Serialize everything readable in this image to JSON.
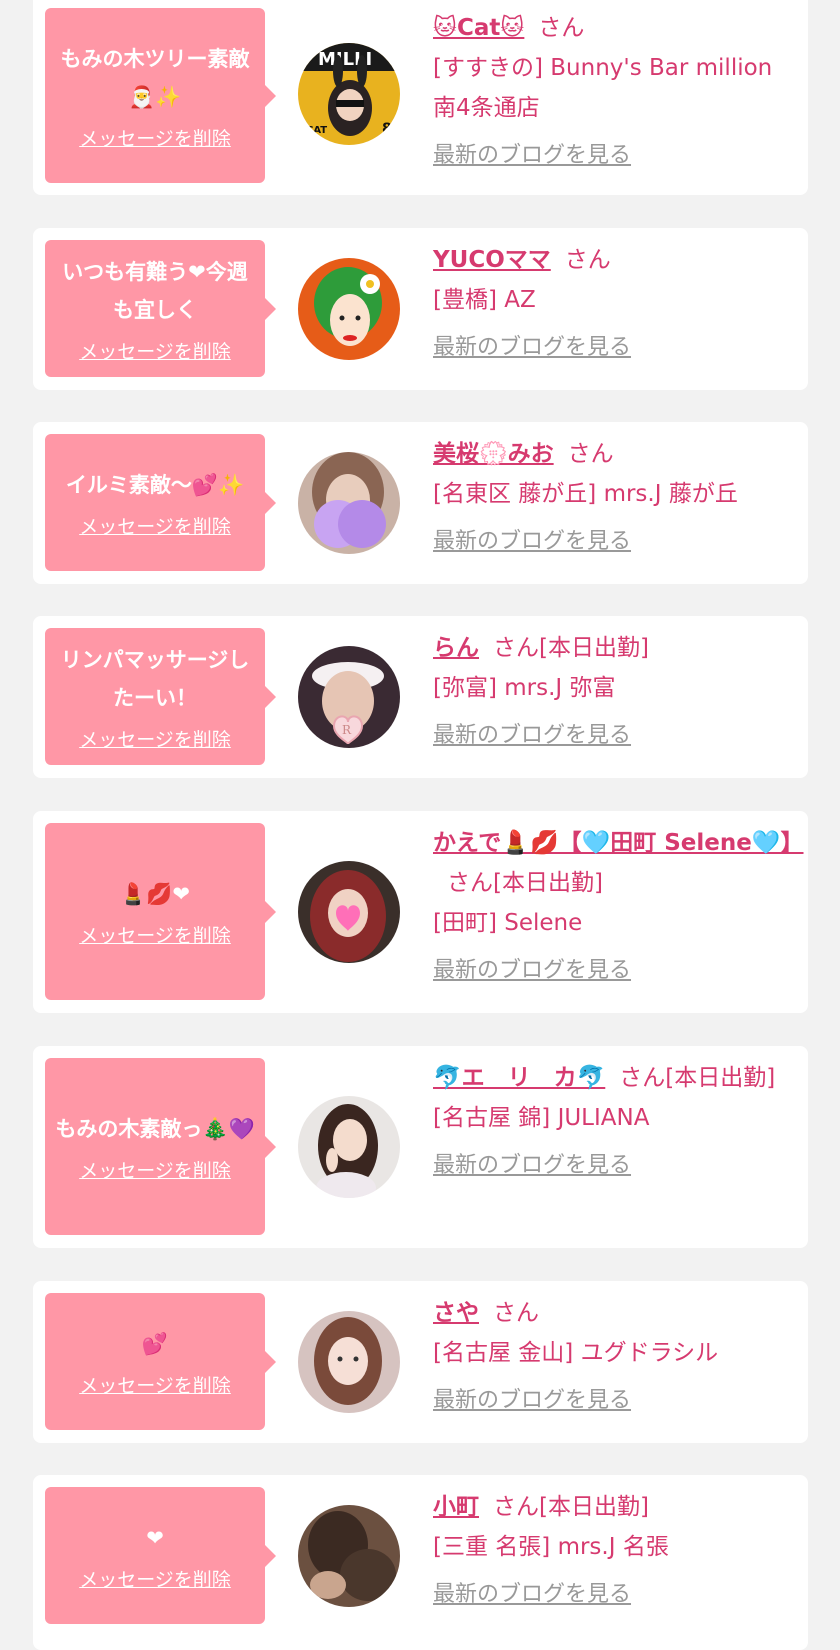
{
  "labels": {
    "delete": "メッセージを削除",
    "blog": "最新のブログを見る",
    "san": "さん"
  },
  "cards": [
    {
      "message": "もみの木ツリー素敵🎅✨",
      "name": "🐱Cat🐱",
      "suffix": "さん",
      "shop": "[すすきの] Bunny's Bar million 南4条通店"
    },
    {
      "message": "いつも有難う❤今週も宜しく",
      "name": "YUCOママ",
      "suffix": "さん",
      "shop": "[豊橋] AZ"
    },
    {
      "message": "イルミ素敵〜💕✨",
      "name": "美桜💮みお",
      "suffix": "さん",
      "shop": "[名東区 藤が丘] mrs.J 藤が丘"
    },
    {
      "message": "リンパマッサージしたーい！",
      "name": "らん",
      "suffix": "さん[本日出勤]",
      "shop": "[弥富] mrs.J 弥富"
    },
    {
      "message": "💄💋❤",
      "name": "かえで💄💋【🩵田町 Selene🩵】",
      "suffix": "さん[本日出勤]",
      "shop": "[田町] Selene"
    },
    {
      "message": "もみの木素敵っ🎄💜",
      "name": "🐬エ　リ　カ🐬",
      "suffix": "さん[本日出勤]",
      "shop": "[名古屋 錦] JULIANA"
    },
    {
      "message": "💕",
      "name": "さや",
      "suffix": "さん",
      "shop": "[名古屋 金山] ユグドラシル"
    },
    {
      "message": "❤",
      "name": "小町",
      "suffix": "さん[本日出勤]",
      "shop": "[三重 名張] mrs.J 名張"
    }
  ],
  "colors": {
    "accent": "#d63a6f",
    "bubble": "#ff97a6",
    "background": "#f2f2f2",
    "link_gray": "#999999"
  }
}
